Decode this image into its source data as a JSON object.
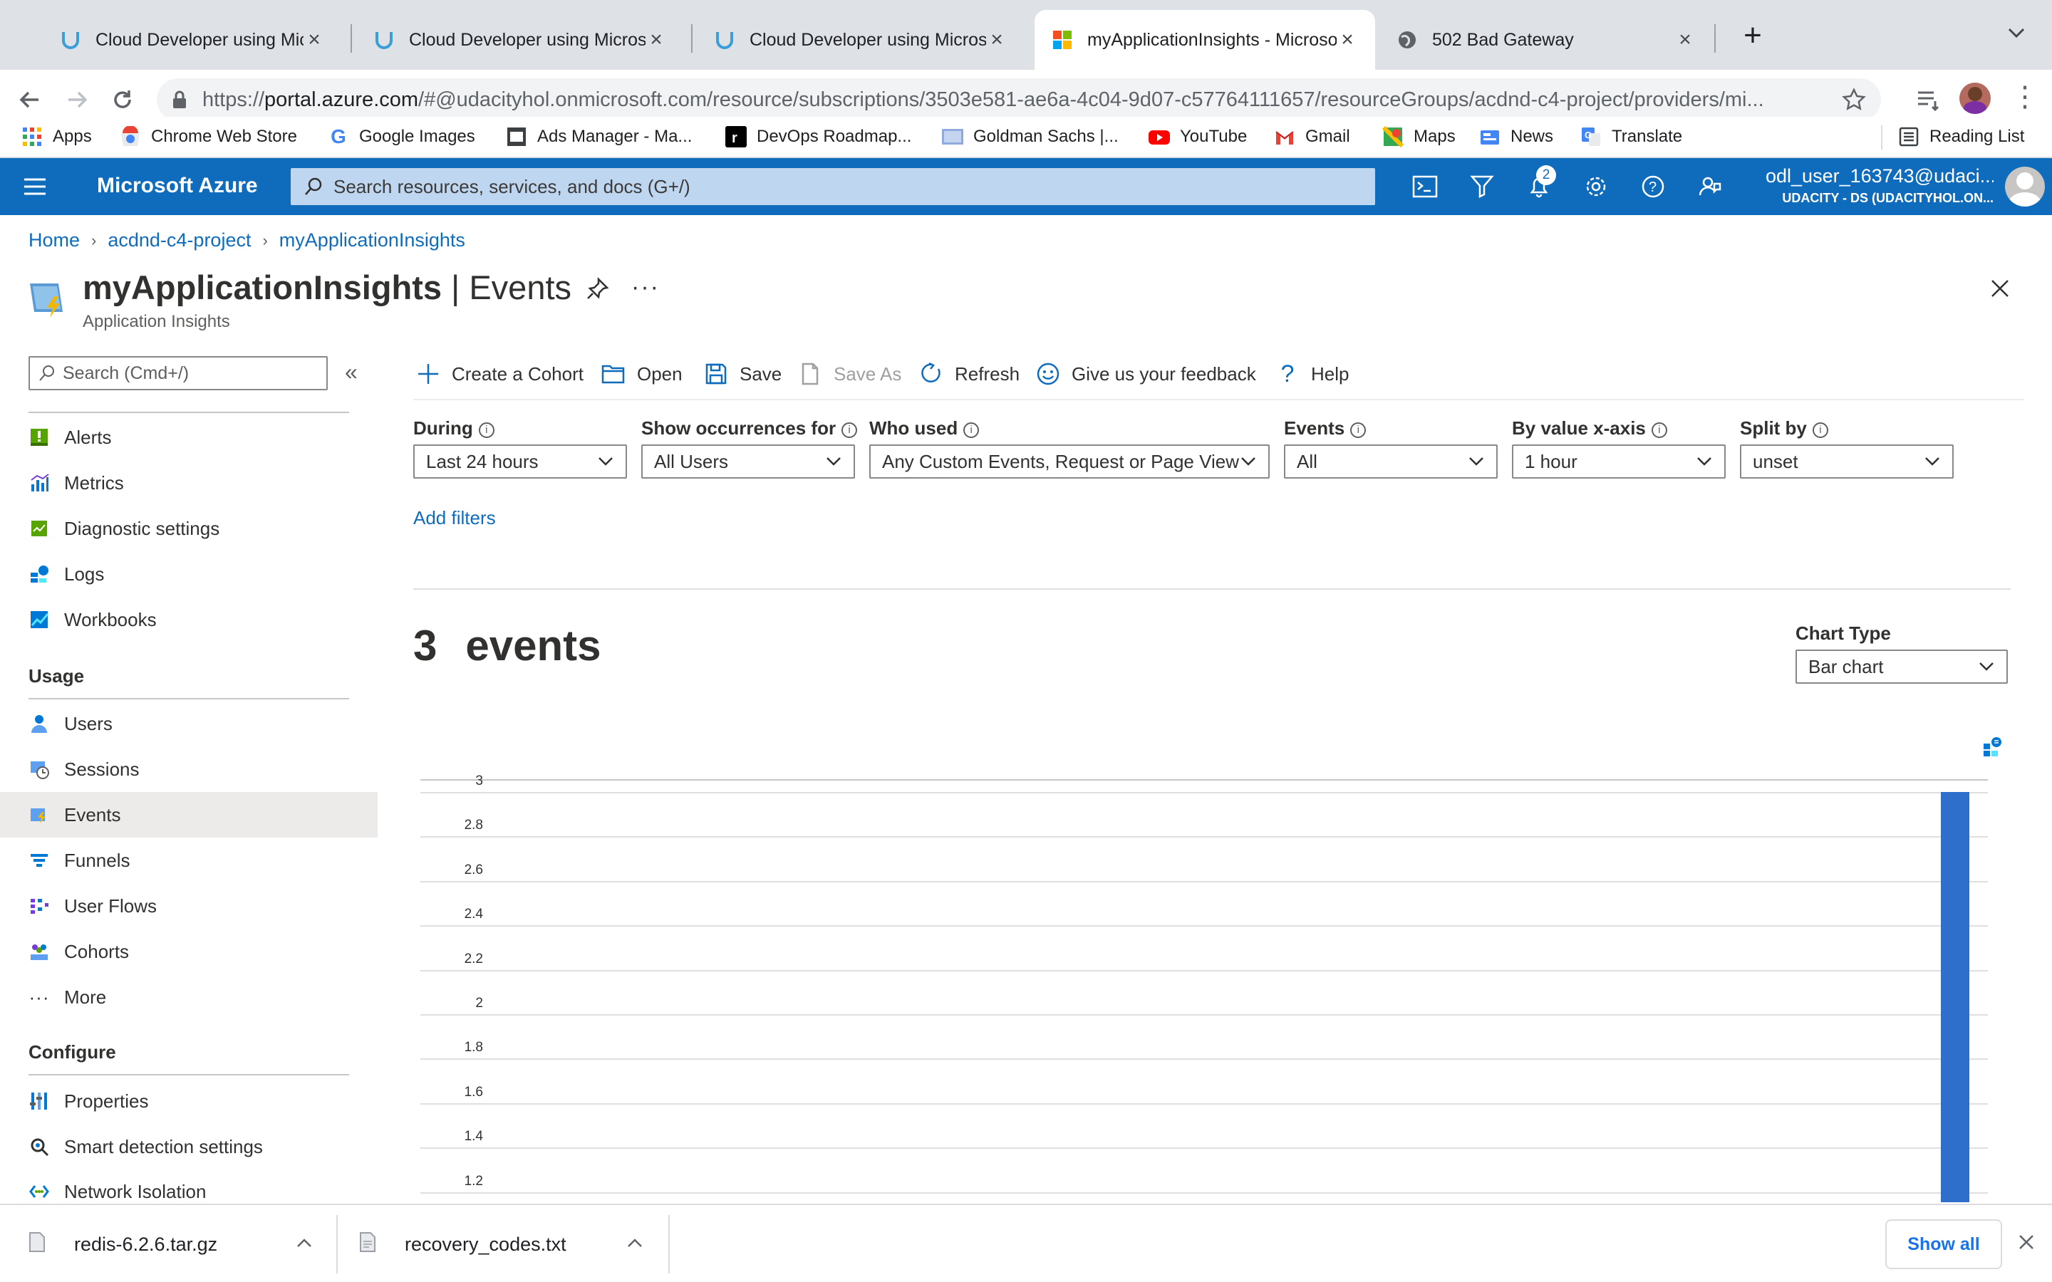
{
  "browser": {
    "tabs": [
      {
        "title": "Cloud Developer using Microsoft Azure",
        "active": false,
        "favicon": "udacity-icon"
      },
      {
        "title": "Cloud Developer using Microsoft Azure",
        "active": false,
        "favicon": "udacity-icon"
      },
      {
        "title": "Cloud Developer using Microsoft Azure",
        "active": false,
        "favicon": "udacity-icon"
      },
      {
        "title": "myApplicationInsights - Microsoft Azure",
        "active": true,
        "favicon": "microsoft-icon"
      },
      {
        "title": "502 Bad Gateway",
        "active": false,
        "favicon": "globe-icon"
      }
    ],
    "url_prefix": "https://",
    "url_host": "portal.azure.com",
    "url_rest": "/#@udacityhol.onmicrosoft.com/resource/subscriptions/3503e581-ae6a-4c04-9d07-c57764111657/resourceGroups/acdnd-c4-project/providers/mi...",
    "bookmarks": [
      "Apps",
      "Chrome Web Store",
      "Google Images",
      "Ads Manager - Ma...",
      "DevOps Roadmap...",
      "Goldman Sachs |...",
      "YouTube",
      "Gmail",
      "Maps",
      "News",
      "Translate"
    ],
    "reading_list": "Reading List"
  },
  "azure": {
    "brand": "Microsoft Azure",
    "search_placeholder": "Search resources, services, and docs (G+/)",
    "notification_count": "2",
    "user_name": "odl_user_163743@udaci...",
    "user_tenant": "UDACITY - DS (UDACITYHOL.ON..."
  },
  "breadcrumb": [
    "Home",
    "acdnd-c4-project",
    "myApplicationInsights"
  ],
  "page": {
    "resource": "myApplicationInsights",
    "separator": " | ",
    "blade": "Events",
    "subtitle": "Application Insights"
  },
  "sidebar": {
    "search_placeholder": "Search (Cmd+/)",
    "top_items": [
      "Alerts",
      "Metrics",
      "Diagnostic settings",
      "Logs",
      "Workbooks"
    ],
    "usage_heading": "Usage",
    "usage_items": [
      "Users",
      "Sessions",
      "Events",
      "Funnels",
      "User Flows",
      "Cohorts",
      "More"
    ],
    "configure_heading": "Configure",
    "configure_items": [
      "Properties",
      "Smart detection settings",
      "Network Isolation"
    ]
  },
  "commands": {
    "create_cohort": "Create a Cohort",
    "open": "Open",
    "save": "Save",
    "save_as": "Save As",
    "refresh": "Refresh",
    "feedback": "Give us your feedback",
    "help": "Help"
  },
  "filters": {
    "during_label": "During",
    "during_value": "Last 24 hours",
    "occurrences_label": "Show occurrences for",
    "occurrences_value": "All Users",
    "who_used_label": "Who used",
    "who_used_value": "Any Custom Events, Request or Page View",
    "events_label": "Events",
    "events_value": "All",
    "xaxis_label": "By value x-axis",
    "xaxis_value": "1 hour",
    "split_label": "Split by",
    "split_value": "unset",
    "add_filters": "Add filters"
  },
  "summary": {
    "count": "3",
    "unit": "events",
    "chart_type_label": "Chart Type",
    "chart_type_value": "Bar chart"
  },
  "chart_data": {
    "type": "bar",
    "y_ticks": [
      "3",
      "2.8",
      "2.6",
      "2.4",
      "2.2",
      "2",
      "1.8",
      "1.6",
      "1.4",
      "1.2"
    ],
    "ylim_visible": [
      1.1,
      3.05
    ],
    "series": [
      {
        "values": [
          3
        ]
      }
    ],
    "bar_color": "#2f6fcc",
    "grid": true
  },
  "downloads": {
    "items": [
      "redis-6.2.6.tar.gz",
      "recovery_codes.txt"
    ],
    "show_all": "Show all"
  },
  "colors": {
    "azure_header": "#0f6cbd",
    "azure_search": "#bed6f0",
    "link": "#0f6cbd",
    "bar": "#2f6fcc"
  }
}
